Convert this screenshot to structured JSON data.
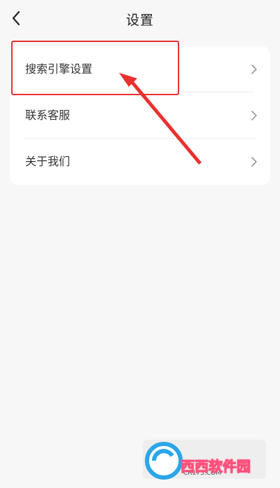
{
  "header": {
    "back_icon": "chevron-left-icon",
    "title": "设置"
  },
  "settings": {
    "items": [
      {
        "label": "搜索引擎设置",
        "icon": "chevron-right-icon"
      },
      {
        "label": "联系客服",
        "icon": "chevron-right-icon"
      },
      {
        "label": "关于我们",
        "icon": "chevron-right-icon"
      }
    ]
  },
  "annotation": {
    "color": "#e8312f"
  },
  "watermark": {
    "text": "西西软件园",
    "subtext": "CR173.COM"
  }
}
